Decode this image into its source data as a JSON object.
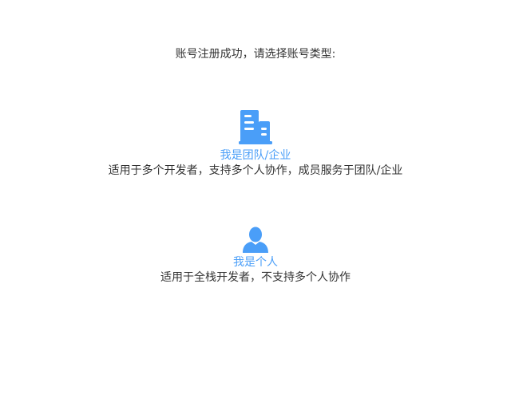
{
  "prompt": "账号注册成功，请选择账号类型:",
  "accent_color": "#4a9ef8",
  "options": [
    {
      "icon": "building-icon",
      "title": "我是团队/企业",
      "description": "适用于多个开发者，支持多个人协作，成员服务于团队/企业"
    },
    {
      "icon": "user-icon",
      "title": "我是个人",
      "description": "适用于全栈开发者，不支持多个人协作"
    }
  ]
}
